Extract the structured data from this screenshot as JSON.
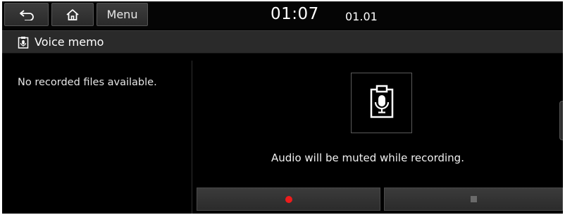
{
  "statusbar": {
    "back_icon": "back-arrow-icon",
    "home_icon": "home-icon",
    "menu_label": "Menu",
    "time": "01:07",
    "date": "01.01"
  },
  "titlebar": {
    "icon": "voice-memo-icon",
    "title": "Voice memo"
  },
  "files_panel": {
    "empty_message": "No recorded files available."
  },
  "recorder": {
    "icon": "microphone-icon",
    "message": "Audio will be muted while recording.",
    "record_icon": "record-dot-icon",
    "stop_icon": "stop-square-icon",
    "record_color": "#ee1c1c"
  }
}
